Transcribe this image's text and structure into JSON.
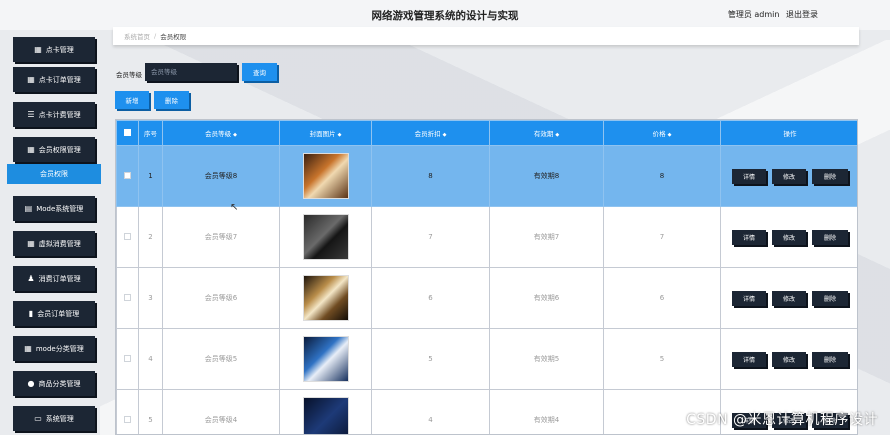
{
  "header": {
    "title": "网络游戏管理系统的设计与实现",
    "user_label": "管理员 admin",
    "logout": "退出登录"
  },
  "sidebar": {
    "items": [
      {
        "label": "点卡管理",
        "icon": "grid-icon",
        "glyph": "▦"
      },
      {
        "label": "点卡订单管理",
        "icon": "grid-icon",
        "glyph": "▦"
      },
      {
        "label": "点卡计费管理",
        "icon": "list-icon",
        "glyph": "☰"
      },
      {
        "label": "会员权限管理",
        "icon": "grid-icon",
        "glyph": "▦"
      },
      {
        "label": "Mode系统管理",
        "icon": "clipboard-icon",
        "glyph": "▤"
      },
      {
        "label": "虚拟消费管理",
        "icon": "table-icon",
        "glyph": "▦"
      },
      {
        "label": "消费订单管理",
        "icon": "user-icon",
        "glyph": "♟"
      },
      {
        "label": "会员订单管理",
        "icon": "bar-chart-icon",
        "glyph": "▮"
      },
      {
        "label": "mode分类管理",
        "icon": "grid-icon",
        "glyph": "▦"
      },
      {
        "label": "商品分类管理",
        "icon": "pin-icon",
        "glyph": "●"
      },
      {
        "label": "系统管理",
        "icon": "monitor-icon",
        "glyph": "▭"
      }
    ],
    "active_sub": "会员权限"
  },
  "breadcrumb": {
    "home": "系统首页",
    "sep": "/",
    "current": "会员权限"
  },
  "search": {
    "label": "会员等级",
    "placeholder": "会员等级",
    "query_button": "查询"
  },
  "toolbar": {
    "add": "新增",
    "delete": "删除"
  },
  "table": {
    "columns": [
      "序号",
      "会员等级",
      "封面图片",
      "会员折扣",
      "有效期",
      "价格",
      "操作"
    ],
    "sort_glyph": "◆",
    "rows": [
      {
        "index": "1",
        "level": "会员等级8",
        "discount": "8",
        "validity": "有效期8",
        "price": "8",
        "selected": true
      },
      {
        "index": "2",
        "level": "会员等级7",
        "discount": "7",
        "validity": "有效期7",
        "price": "7",
        "selected": false
      },
      {
        "index": "3",
        "level": "会员等级6",
        "discount": "6",
        "validity": "有效期6",
        "price": "6",
        "selected": false
      },
      {
        "index": "4",
        "level": "会员等级5",
        "discount": "5",
        "validity": "有效期5",
        "price": "5",
        "selected": false
      },
      {
        "index": "5",
        "level": "会员等级4",
        "discount": "4",
        "validity": "有效期4",
        "price": "",
        "selected": false
      }
    ],
    "ops": {
      "detail": "详情",
      "edit": "修改",
      "remove": "删除"
    }
  },
  "watermark": "CSDN @米恩计算机程序设计",
  "colors": {
    "primary": "#1e90ee",
    "dark": "#1c2634",
    "selected_row": "#74b6ee"
  }
}
